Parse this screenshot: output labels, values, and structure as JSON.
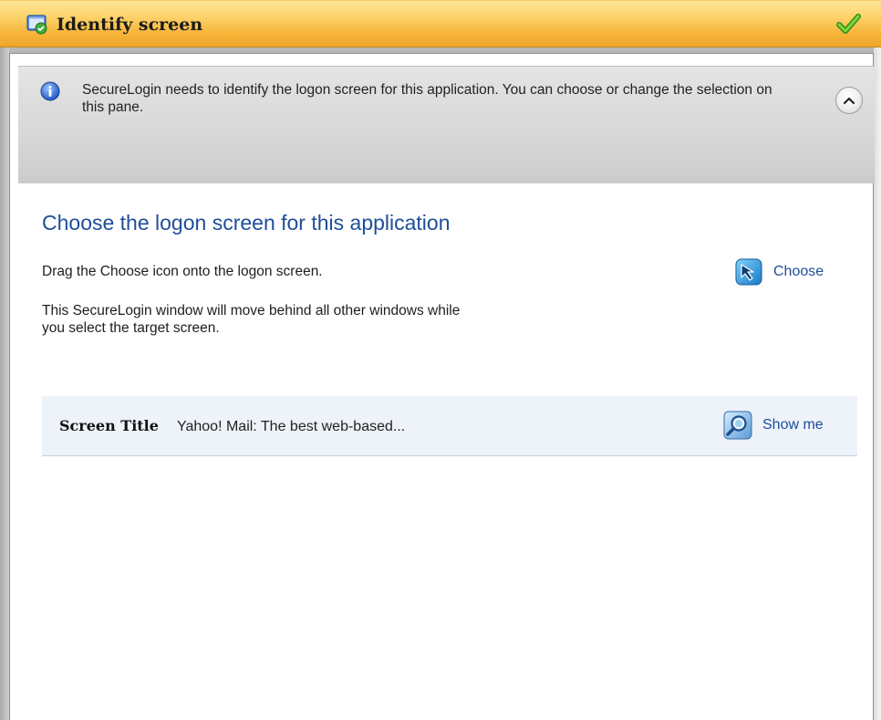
{
  "window": {
    "title": "Identify screen",
    "title_icon": "identify-screen-icon",
    "status_icon": "green-check-icon"
  },
  "info": {
    "icon": "info-icon",
    "text": "SecureLogin needs to identify the logon screen for this application. You can choose or change the selection on this pane.",
    "collapse_icon": "chevron-up-icon"
  },
  "main": {
    "heading": "Choose the logon screen for this application",
    "drag_instruction": "Drag the Choose icon onto the logon screen.",
    "move_note": "This SecureLogin window will move behind all other windows while you select the target screen.",
    "choose_label": "Choose",
    "choose_icon": "choose-arrow-icon"
  },
  "screen": {
    "label": "Screen Title",
    "value": "Yahoo! Mail: The best web-based...",
    "show_me_label": "Show me",
    "show_me_icon": "magnifier-icon"
  },
  "colors": {
    "titlebar": "#f6b63a",
    "link": "#1f4e9a",
    "heading": "#1f4e9a",
    "info_pane": "#d7d7d7",
    "screen_band": "#eef2f9"
  }
}
